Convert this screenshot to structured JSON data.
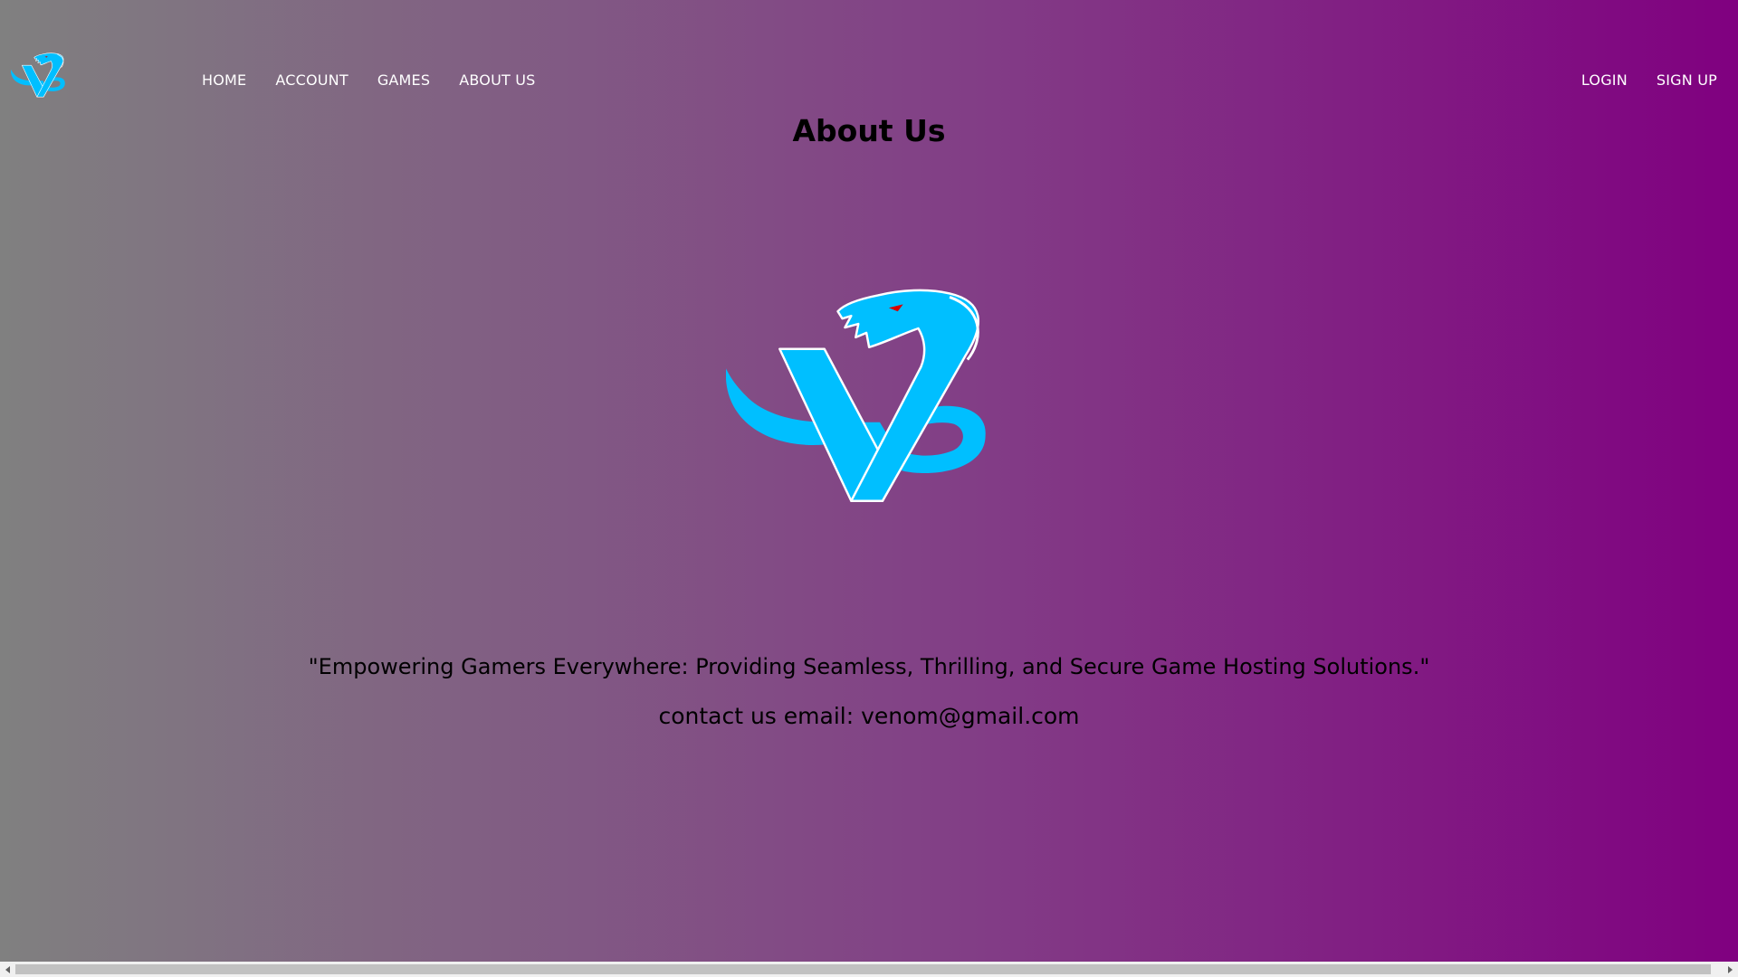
{
  "brand": {
    "logo_icon": "venom-snake-v-logo",
    "logo_color": "#00bfff",
    "logo_outline": "#ffffff"
  },
  "nav": {
    "links": [
      {
        "label": "HOME"
      },
      {
        "label": "ACCOUNT"
      },
      {
        "label": "GAMES"
      },
      {
        "label": "ABOUT US"
      }
    ],
    "login_label": "LOGIN",
    "signup_label": "SIGN UP"
  },
  "main": {
    "title": "About Us",
    "tagline": "\"Empowering Gamers Everywhere: Providing Seamless, Thrilling, and Secure Game Hosting Solutions.\"",
    "contact": "contact us email: venom@gmail.com"
  },
  "theme": {
    "gradient_start": "#808080",
    "gradient_end": "#800080",
    "nav_text": "#ffffff",
    "body_text": "#000000"
  }
}
